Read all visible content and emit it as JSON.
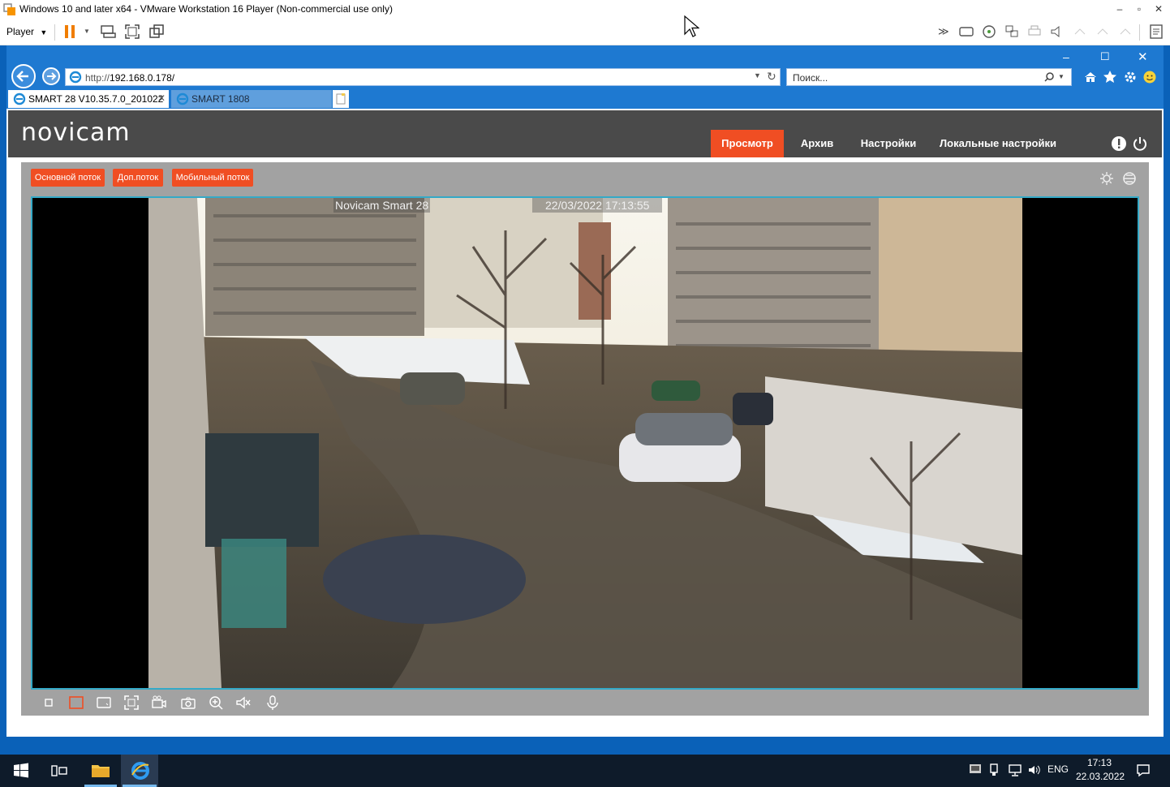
{
  "vm": {
    "title": "Windows 10 and later x64 - VMware Workstation 16 Player (Non-commercial use only)",
    "player_menu": "Player"
  },
  "ie": {
    "url_prefix": "http://",
    "url_host": "192.168.0.178/",
    "search_placeholder": "Поиск...",
    "tabs": [
      {
        "label": "SMART 28 V10.35.7.0_201022",
        "active": true
      },
      {
        "label": "SMART 1808",
        "active": false
      }
    ]
  },
  "app": {
    "logo": "novicam",
    "nav": [
      {
        "label": "Просмотр",
        "active": true
      },
      {
        "label": "Архив"
      },
      {
        "label": "Настройки"
      },
      {
        "label": "Локальные настройки"
      }
    ],
    "streams": [
      "Основной поток",
      "Доп.поток",
      "Мобильный поток"
    ],
    "osd_name": "Novicam Smart 28",
    "osd_time": "22/03/2022 17:13:55"
  },
  "taskbar": {
    "lang": "ENG",
    "time": "17:13",
    "date": "22.03.2022"
  },
  "colors": {
    "accent": "#f04e23",
    "header": "#4a4a4a",
    "viewport_border": "#34a9c7",
    "ie_blue": "#1e79d1"
  }
}
